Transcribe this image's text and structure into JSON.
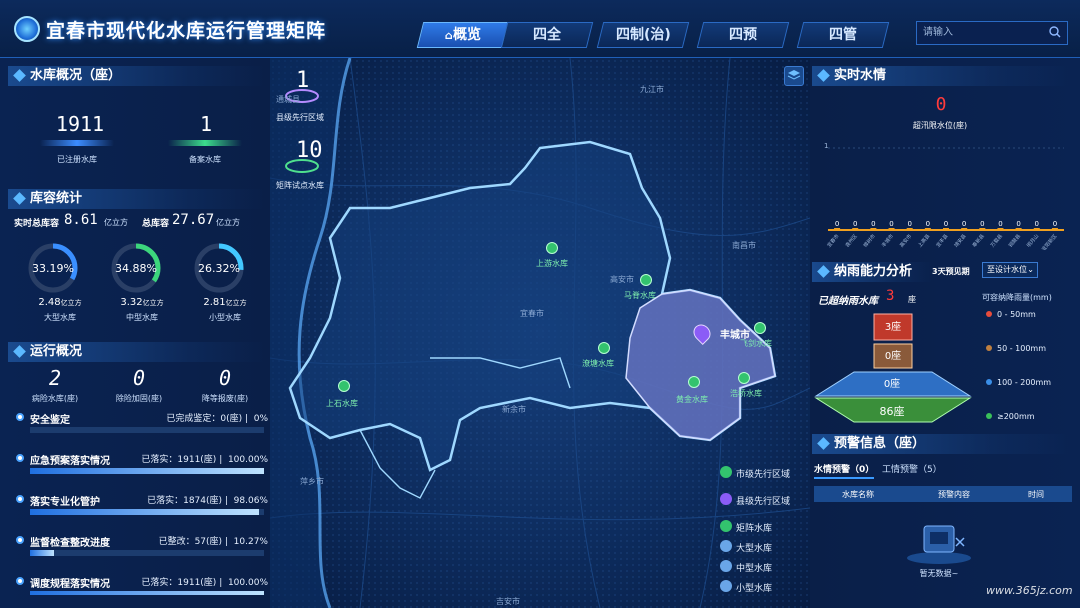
{
  "header": {
    "title": "宜春市现代化水库运行管理矩阵",
    "tabs": [
      "概览",
      "四全",
      "四制(治)",
      "四预",
      "四管"
    ],
    "search_placeholder": "请输入"
  },
  "left": {
    "overview": {
      "title": "水库概况（座）",
      "registered_value": "1911",
      "registered_label": "已注册水库",
      "filed_value": "1",
      "filed_label": "备案水库"
    },
    "capacity": {
      "title": "库容统计",
      "realtime_label": "实时总库容",
      "realtime_value": "8.61",
      "realtime_unit": "亿立方",
      "total_label": "总库容",
      "total_value": "27.67",
      "total_unit": "亿立方",
      "rings": [
        {
          "percent": "33.19%",
          "value": "2.48",
          "unit": "亿立方",
          "label": "大型水库",
          "fraction": 0.3319
        },
        {
          "percent": "34.88%",
          "value": "3.32",
          "unit": "亿立方",
          "label": "中型水库",
          "fraction": 0.3488
        },
        {
          "percent": "26.32%",
          "value": "2.81",
          "unit": "亿立方",
          "label": "小型水库",
          "fraction": 0.2632
        }
      ]
    },
    "operation": {
      "title": "运行概况",
      "stats": [
        {
          "value": "2",
          "label": "病险水库(座)"
        },
        {
          "value": "0",
          "label": "除险加固(座)"
        },
        {
          "value": "0",
          "label": "降等报废(座)"
        }
      ],
      "progress": [
        {
          "title": "安全鉴定",
          "stat": "已完成鉴定：0(座)",
          "percent": "0%",
          "fraction": 0.0
        },
        {
          "title": "应急预案落实情况",
          "stat": "已落实：1911(座)",
          "percent": "100.00%",
          "fraction": 1.0
        },
        {
          "title": "落实专业化管护",
          "stat": "已落实：1874(座)",
          "percent": "98.06%",
          "fraction": 0.9806
        },
        {
          "title": "监督检查整改进度",
          "stat": "已整改：57(座)",
          "percent": "10.27%",
          "fraction": 0.1027
        },
        {
          "title": "调度规程落实情况",
          "stat": "已落实：1911(座)",
          "percent": "100.00%",
          "fraction": 1.0
        }
      ]
    }
  },
  "map": {
    "county_count": "1",
    "county_label": "县级先行区域",
    "matrix_count": "10",
    "matrix_label": "矩阵试点水库",
    "reservoirs": [
      "上游水库",
      "马脊水库",
      "潦塘水库",
      "上石水库",
      "黄金水库",
      "浩桥水库",
      "飞剑水库"
    ],
    "county_name": "丰城市",
    "cities": [
      "九江市",
      "南昌市",
      "宜春市",
      "萍乡市",
      "新余市",
      "吉安市",
      "通城县",
      "高安市"
    ],
    "legend": [
      {
        "label": "市级先行区域",
        "color": "#33c36e"
      },
      {
        "label": "县级先行区域",
        "color": "#8b5cf6"
      },
      {
        "label": "矩阵水库",
        "color": "#33c36e"
      },
      {
        "label": "大型水库",
        "color": "#6aa6e8"
      },
      {
        "label": "中型水库",
        "color": "#6aa6e8"
      },
      {
        "label": "小型水库",
        "color": "#6aa6e8"
      }
    ]
  },
  "right": {
    "water": {
      "title": "实时水情",
      "over_value": "0",
      "over_label": "超汛限水位(座)",
      "y_tick": "1",
      "chart_data": {
        "type": "bar",
        "categories": [
          "宜春市",
          "袁州区",
          "樟树市",
          "丰城市",
          "高安市",
          "上高县",
          "宜丰县",
          "靖安县",
          "奉新县",
          "万载县",
          "铜鼓县",
          "明月山",
          "宜阳新区"
        ],
        "values": [
          0,
          0,
          0,
          0,
          0,
          0,
          0,
          0,
          0,
          0,
          0,
          0,
          0
        ],
        "ylim": [
          0,
          1
        ]
      }
    },
    "rain": {
      "title": "纳雨能力分析",
      "forecast_label": "3天预见期",
      "select_label": "至设计水位",
      "over_label": "已超纳雨水库",
      "over_value": "3",
      "over_unit": "座",
      "legend_title": "可容纳降雨量(mm)",
      "levels": [
        {
          "label": "3座",
          "range": "0 - 50mm",
          "color": "#c0392b"
        },
        {
          "label": "0座",
          "range": "50 - 100mm",
          "color": "#8a5a3a"
        },
        {
          "label": "0座",
          "range": "100 - 200mm",
          "color": "#2e6fc4"
        },
        {
          "label": "86座",
          "range": "≥200mm",
          "color": "#3a8f3a"
        }
      ]
    },
    "warning": {
      "title": "预警信息（座）",
      "tabs": [
        "水情预警（0）",
        "工情预警（5）"
      ],
      "columns": [
        "水库名称",
        "预警内容",
        "时间"
      ],
      "empty": "暂无数据~"
    }
  },
  "watermark": "www.365jz.com"
}
